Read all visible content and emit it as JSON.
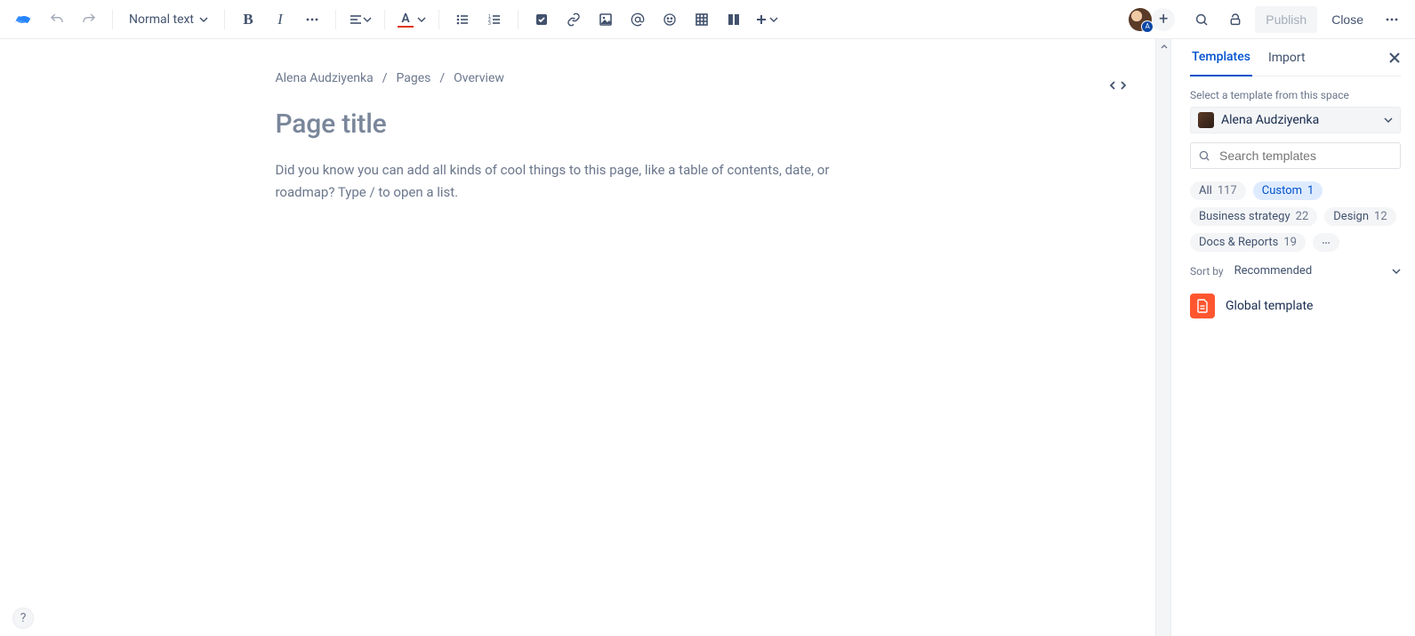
{
  "toolbar": {
    "text_style_label": "Normal text",
    "publish_label": "Publish",
    "close_label": "Close"
  },
  "breadcrumbs": {
    "items": [
      "Alena Audziyenka",
      "Pages",
      "Overview"
    ]
  },
  "editor": {
    "title_placeholder": "Page title",
    "body_hint": "Did you know you can add all kinds of cool things to this page, like a table of contents, date, or roadmap? Type / to open a list."
  },
  "panel": {
    "tabs": {
      "templates": "Templates",
      "import": "Import"
    },
    "select_space_label": "Select a template from this space",
    "space_name": "Alena Audziyenka",
    "search_placeholder": "Search templates",
    "chips": [
      {
        "label": "All",
        "count": "117",
        "active": false
      },
      {
        "label": "Custom",
        "count": "1",
        "active": true
      },
      {
        "label": "Business strategy",
        "count": "22",
        "active": false
      },
      {
        "label": "Design",
        "count": "12",
        "active": false
      },
      {
        "label": "Docs & Reports",
        "count": "19",
        "active": false
      }
    ],
    "sort_label": "Sort by",
    "sort_value": "Recommended",
    "templates": [
      {
        "name": "Global template"
      }
    ]
  }
}
